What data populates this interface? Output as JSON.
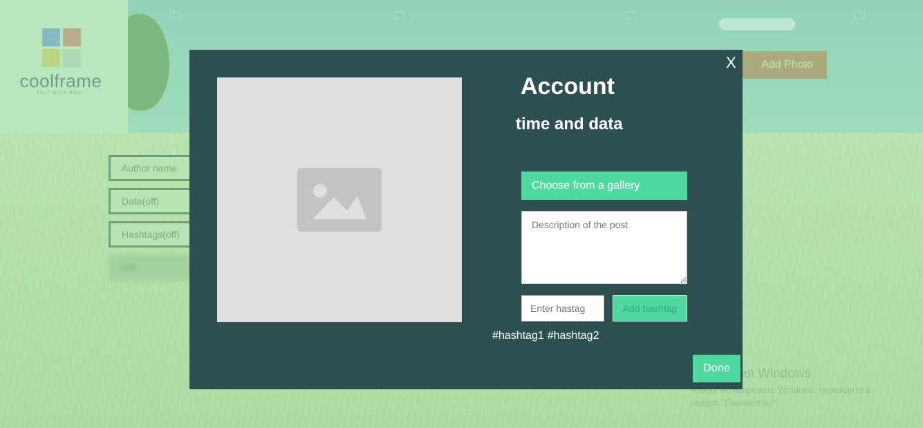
{
  "app": {
    "logo_text": "coolframe",
    "logo_tagline": "EDIT WITH SOUL",
    "logo_colors": [
      "#79aebf",
      "#b59f7d",
      "#b9cf6f",
      "#a9d6b2"
    ]
  },
  "sidebar_form": {
    "author_placeholder": "Author name",
    "date_label": "Date(off)",
    "hashtags_label": "Hashtags(off)",
    "blurred_label": "Add..."
  },
  "header": {
    "add_photo_label": "Add Photo"
  },
  "modal": {
    "close_label": "X",
    "title": "Account",
    "subtitle": "time and data",
    "image_placeholder_icon": "image-icon",
    "gallery_button_label": "Choose from a gallery",
    "description_placeholder": "Description of the post",
    "hashtag_placeholder": "Enter hastag",
    "add_hashtag_label": "Add hashtag",
    "hashtags": [
      "#hashtag1",
      "#hashtag2"
    ],
    "done_label": "Done"
  },
  "watermark": {
    "title": "Активация Windows",
    "line1": "Чтобы активировать Windows, перейдите в",
    "line2": "раздел \"Параметры\"."
  },
  "colors": {
    "modal_bg": "#2e4f4f",
    "accent": "#4fd9a0",
    "add_photo_bg": "#a49c6b"
  }
}
